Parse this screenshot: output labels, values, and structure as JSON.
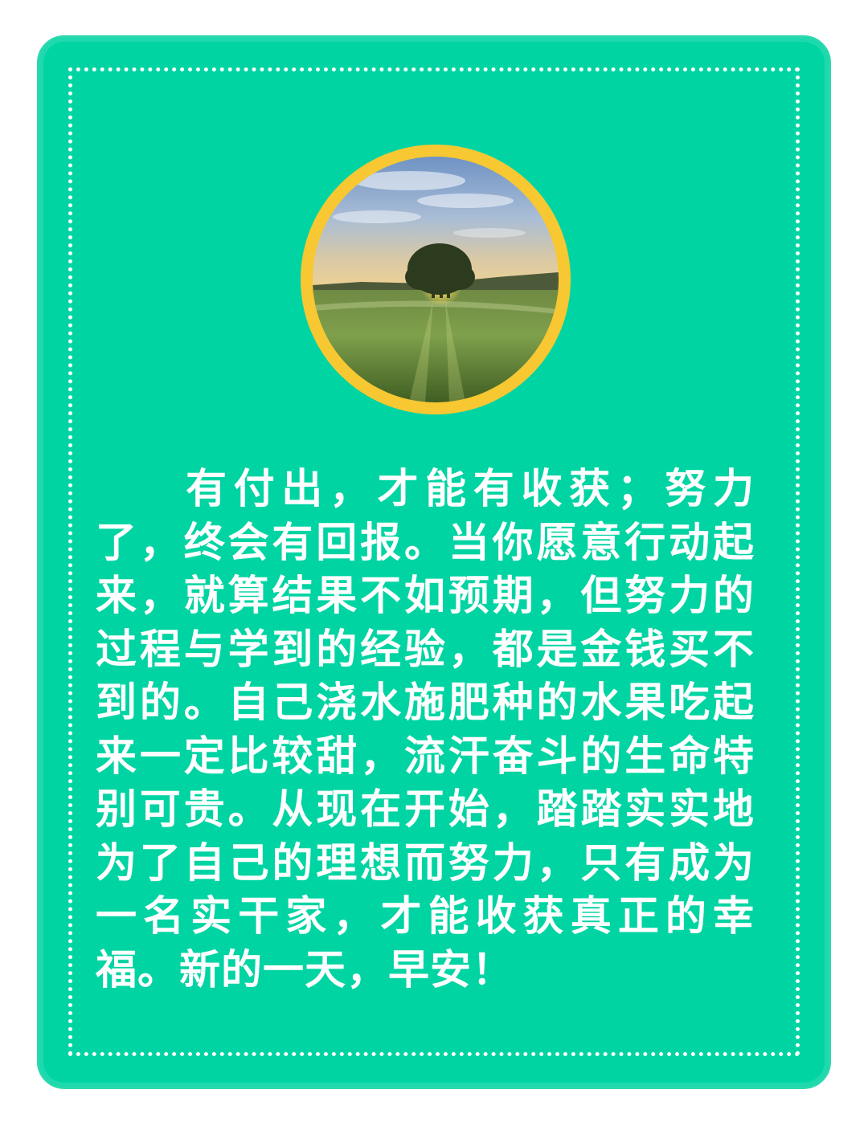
{
  "colors": {
    "card_background": "#00d4a3",
    "ring": "#f7c832",
    "text": "#ffffff",
    "frame_dots": "#ffffff"
  },
  "image": {
    "subject": "lone-tree-at-sunrise"
  },
  "body": {
    "text": "有付出，才能有收获；努力了，终会有回报。当你愿意行动起来，就算结果不如预期，但努力的过程与学到的经验，都是金钱买不到的。自己浇水施肥种的水果吃起来一定比较甜，流汗奋斗的生命特别可贵。从现在开始，踏踏实实地为了自己的理想而努力，只有成为一名实干家，才能收获真正的幸福。新的一天，早安！"
  }
}
